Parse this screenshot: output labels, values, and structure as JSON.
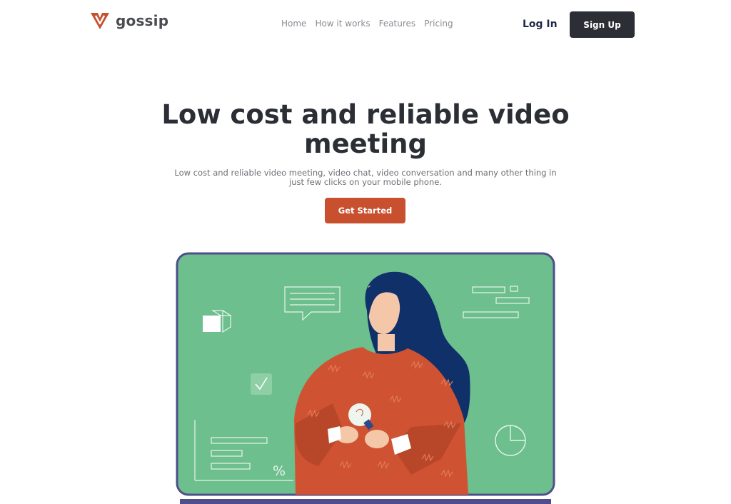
{
  "brand": {
    "name": "gossip",
    "accent": "#c8502f",
    "dark": "#2b2e35"
  },
  "nav": {
    "links": [
      "Home",
      "How it works",
      "Features",
      "Pricing"
    ],
    "login_label": "Log In",
    "signup_label": "Sign Up"
  },
  "hero": {
    "title": "Low cost and reliable video meeting",
    "subtitle": "Low cost and reliable video meeting, video chat, video conversation and many other thing in just few clicks on your mobile phone.",
    "cta_label": "Get Started"
  },
  "illustration": {
    "screen_color": "#6dbf8d",
    "frame_color": "#4f4e8c",
    "percent_symbol": "%"
  }
}
